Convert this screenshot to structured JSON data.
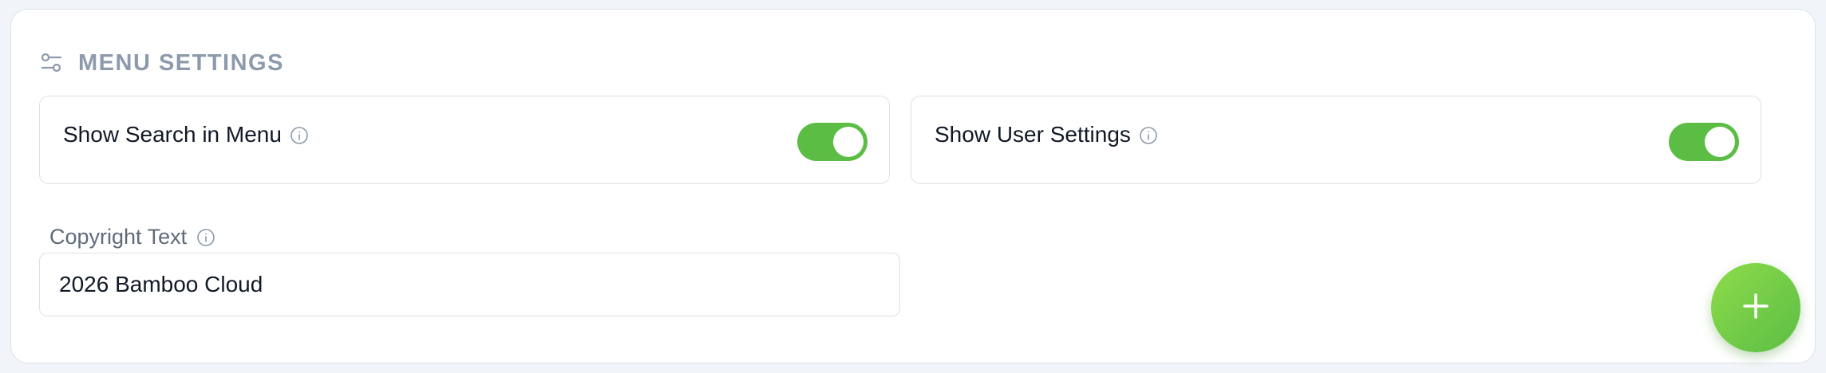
{
  "section": {
    "title": "MENU SETTINGS",
    "icon": "sliders-icon"
  },
  "toggles": [
    {
      "label": "Show Search in Menu",
      "enabled": true,
      "info_icon": "info-icon"
    },
    {
      "label": "Show User Settings",
      "enabled": true,
      "info_icon": "info-icon"
    }
  ],
  "copyright": {
    "label": "Copyright Text",
    "value": "2026 Bamboo Cloud",
    "info_icon": "info-icon"
  },
  "fab": {
    "icon": "plus-icon"
  },
  "colors": {
    "accent": "#5cbd45",
    "accent_light": "#8ddc4a",
    "muted_text": "#8c9aab",
    "border": "#dde1e6"
  }
}
